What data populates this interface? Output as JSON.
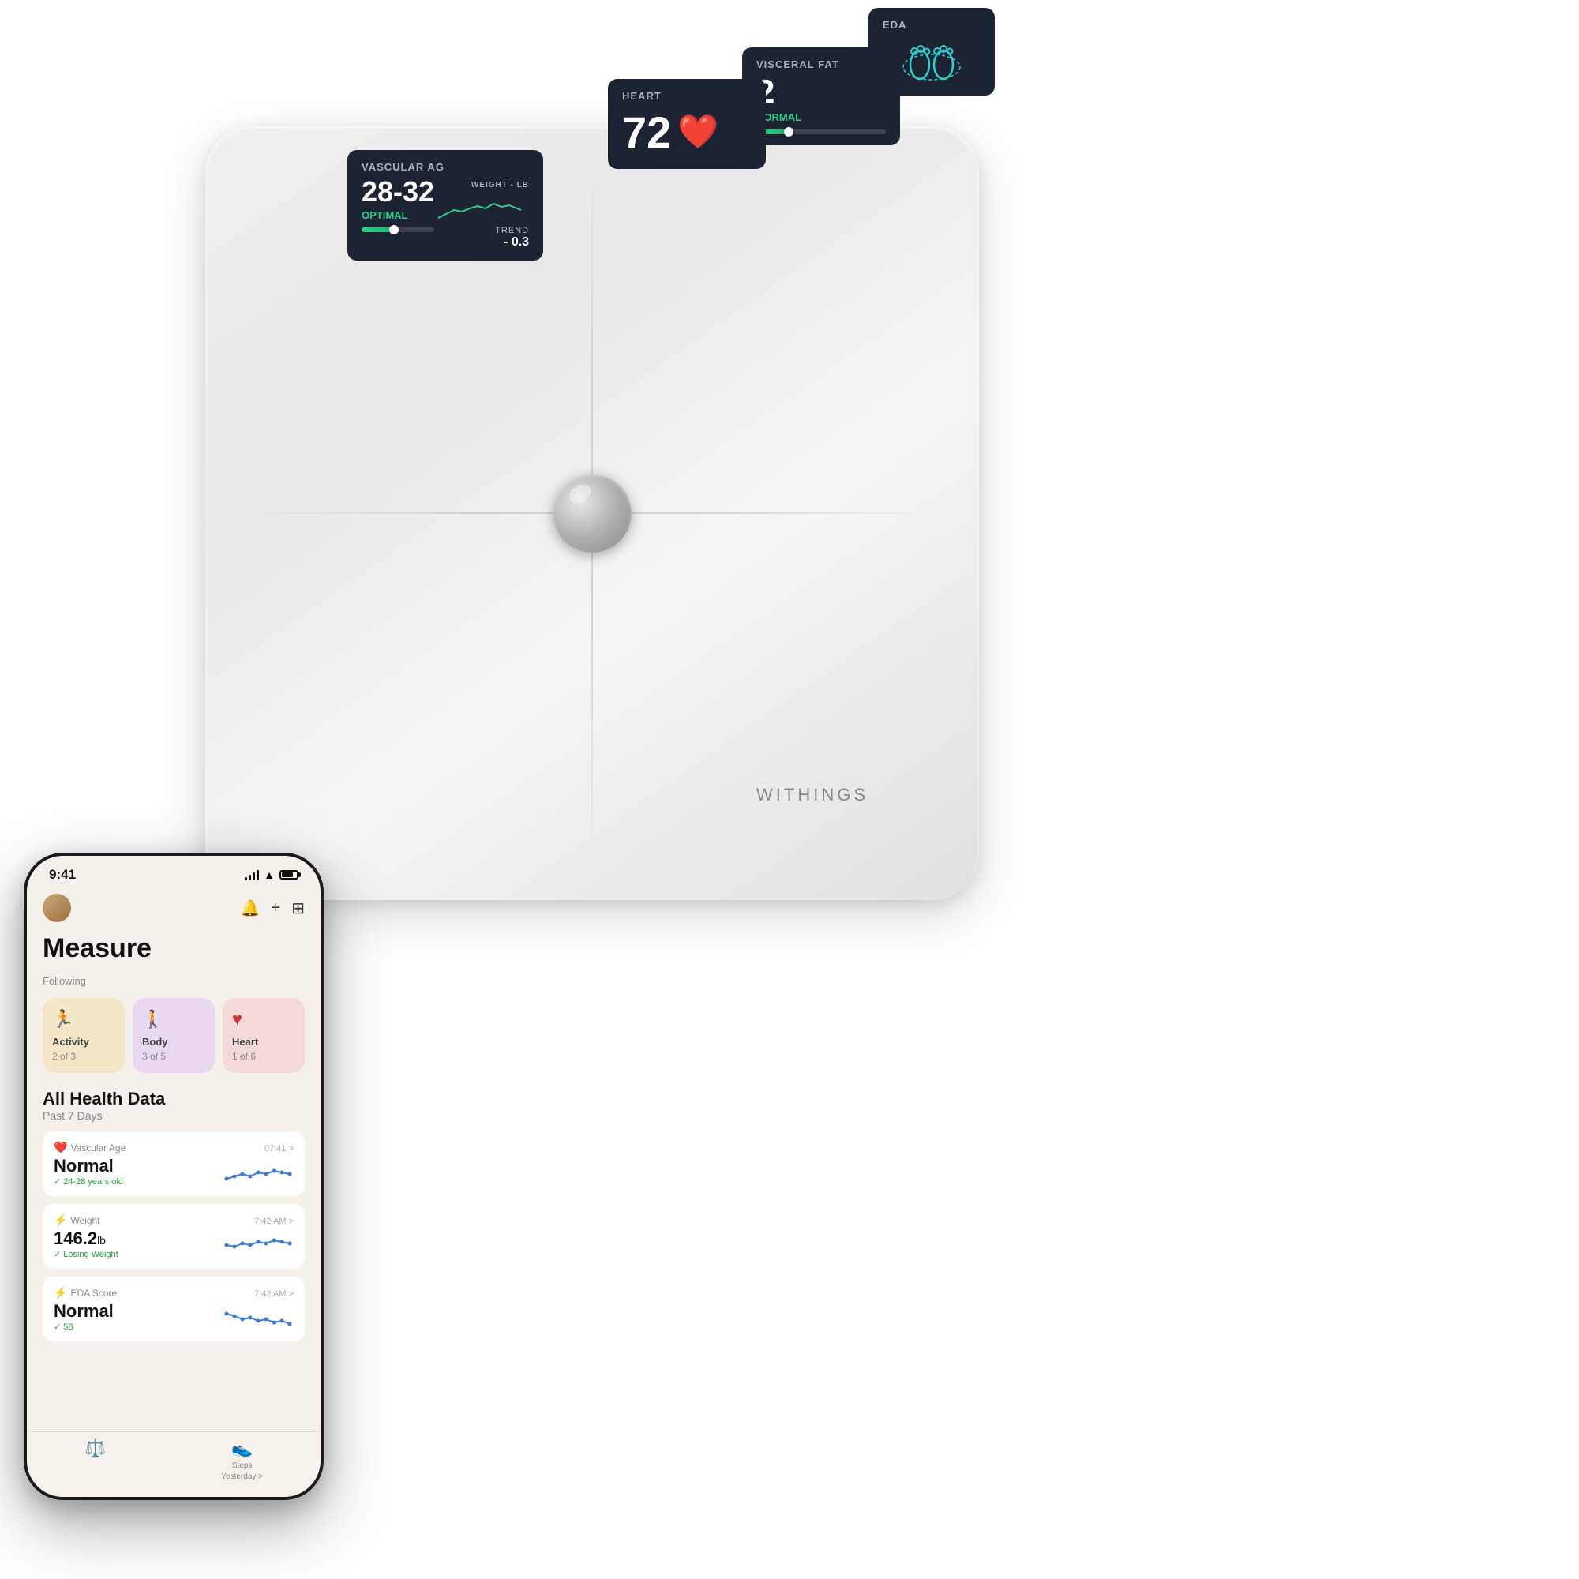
{
  "page": {
    "background": "#ffffff"
  },
  "scale": {
    "brand": "WITHINGS"
  },
  "data_cards": {
    "vascular": {
      "label": "VASCULAR AG",
      "value": "28-32",
      "status": "OPTIMAL",
      "trend_label": "TREND",
      "trend_value": "- 0.3",
      "weight_label": "WEIGHT - LB"
    },
    "heart": {
      "label": "HEART",
      "value": "72"
    },
    "visceral": {
      "label": "VISCERAL FAT",
      "value": "2",
      "status": "NORMAL"
    },
    "eda": {
      "label": "EDA"
    }
  },
  "phone": {
    "status_bar": {
      "time": "9:41"
    },
    "header": {
      "title": "Measure"
    },
    "following": {
      "label": "Following",
      "cards": [
        {
          "title": "Activity",
          "subtitle": "2 of 3",
          "icon": "🏃",
          "color": "activity"
        },
        {
          "title": "Body",
          "subtitle": "3 of 5",
          "icon": "🚶",
          "color": "body"
        },
        {
          "title": "Heart",
          "subtitle": "1 of 6",
          "icon": "♥",
          "color": "heart"
        }
      ]
    },
    "health_data": {
      "title": "All Health Data",
      "subtitle": "Past 7 Days",
      "items": [
        {
          "category": "Vascular Age",
          "category_icon": "❤️",
          "value": "Normal",
          "sub": "24-28 years old",
          "time": "07:41 >"
        },
        {
          "category": "Weight",
          "category_icon": "⚡",
          "value": "146.2",
          "unit": "lb",
          "sub": "Losing Weight",
          "time": "7:42 AM >"
        },
        {
          "category": "EDA Score",
          "category_icon": "⚡",
          "value": "Normal",
          "sub": "58",
          "time": "7:42 AM >"
        },
        {
          "category": "Steps",
          "category_icon": "👟",
          "value": "",
          "sub": "",
          "time": "Yesterday >"
        }
      ]
    }
  }
}
